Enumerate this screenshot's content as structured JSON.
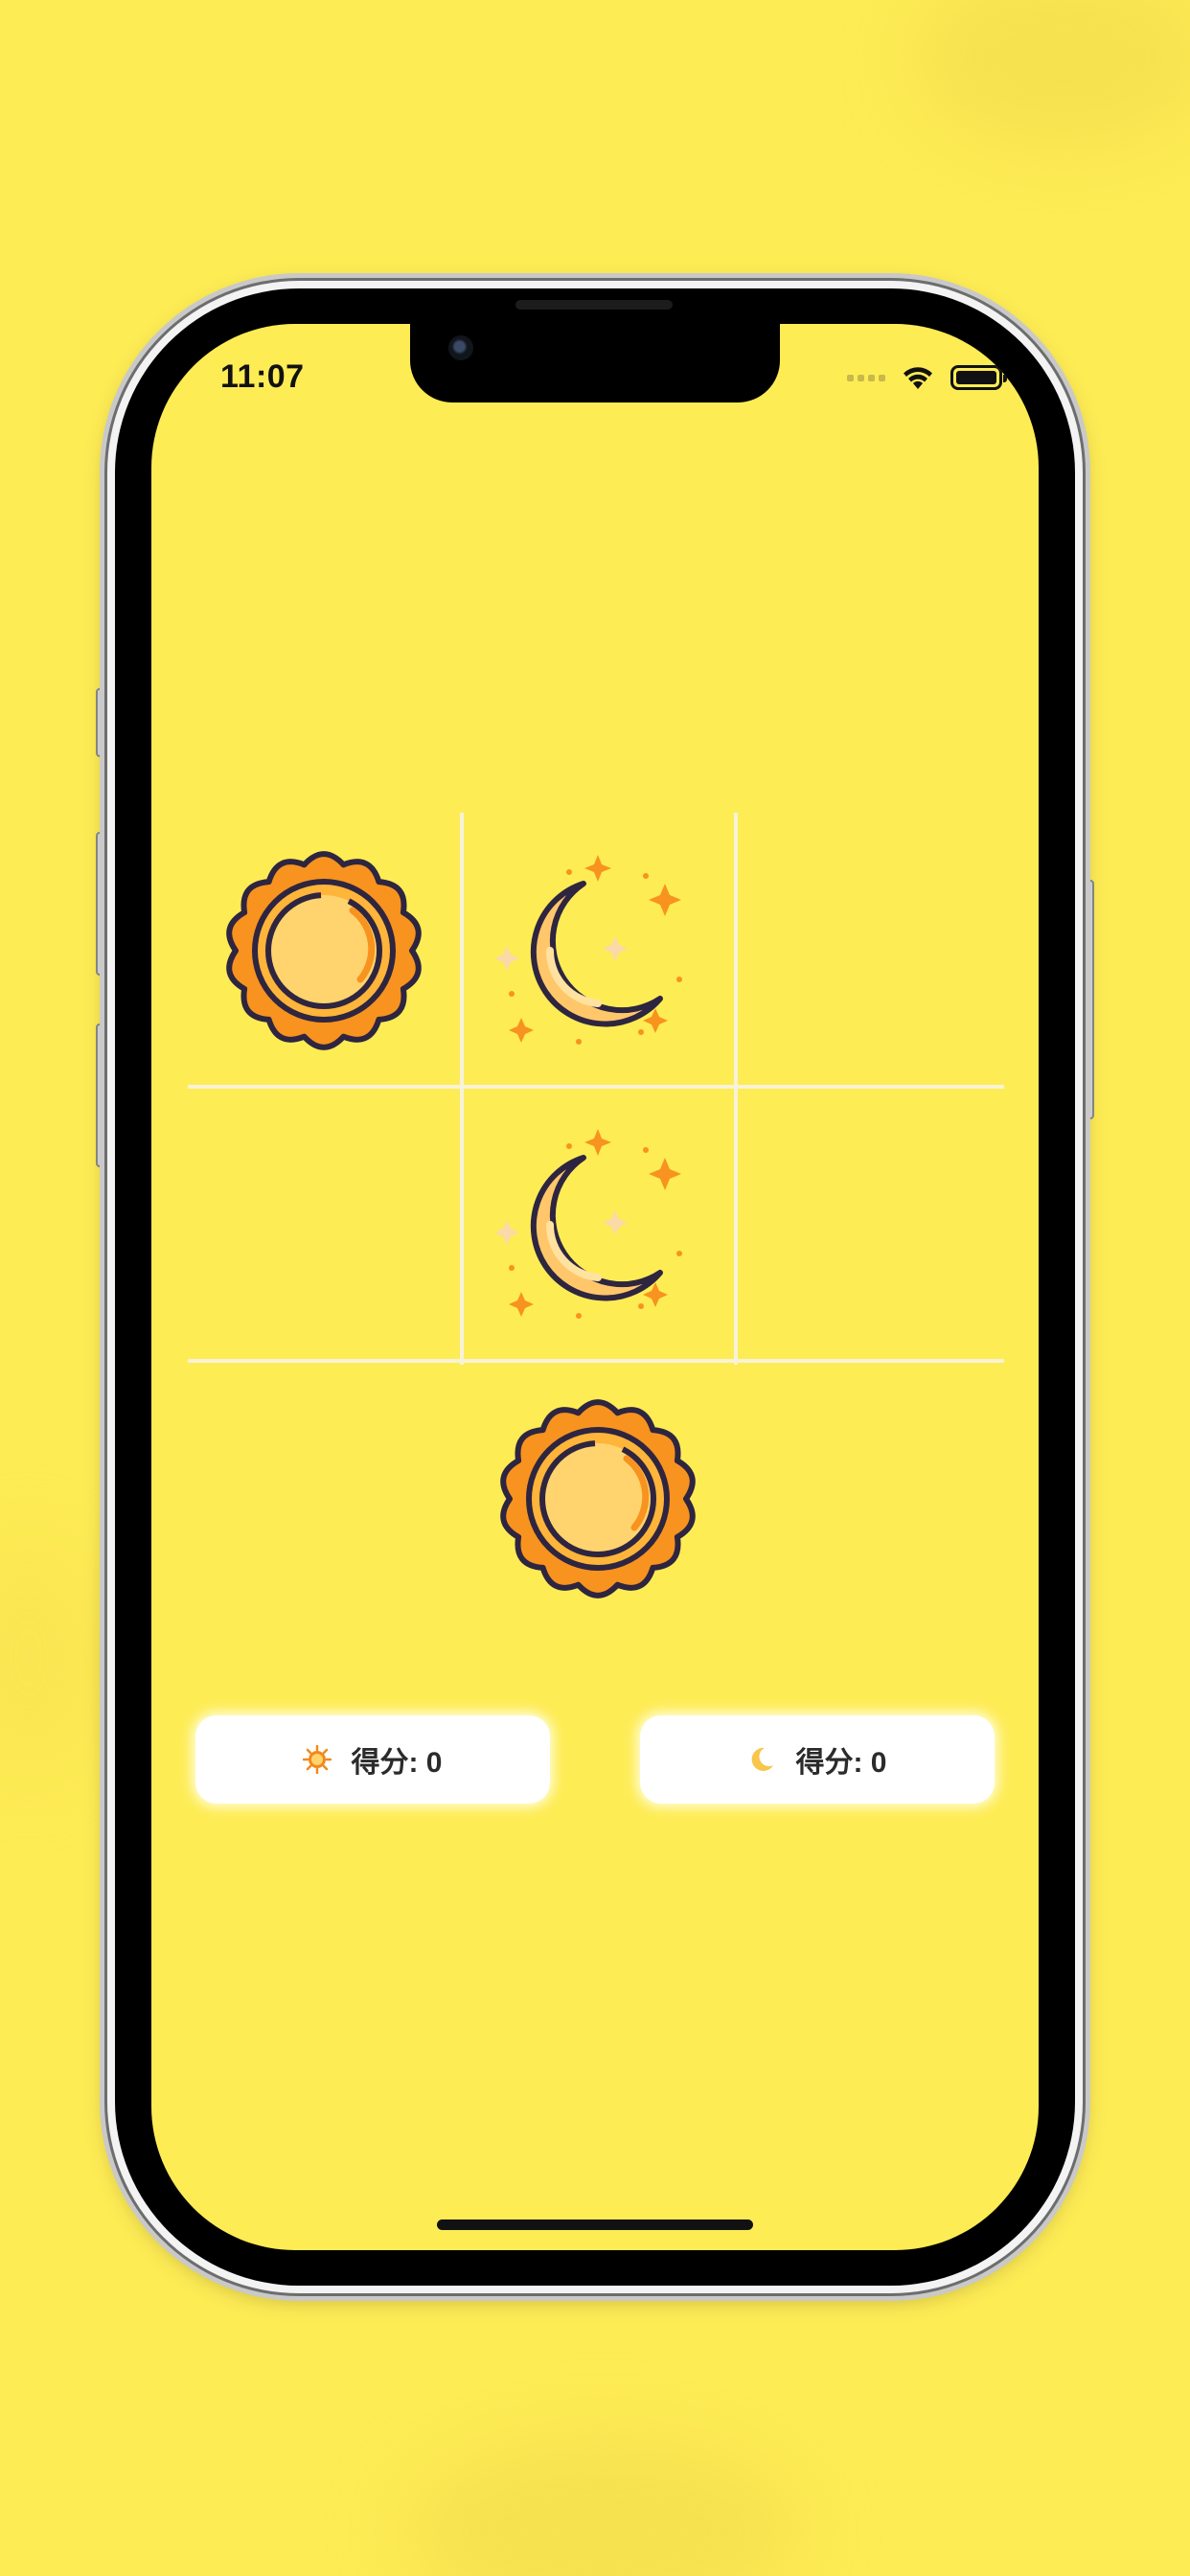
{
  "status_bar": {
    "time": "11:07"
  },
  "board": {
    "cells": [
      "sun",
      "moon",
      "",
      "",
      "moon",
      "",
      "",
      "sun",
      ""
    ]
  },
  "scores": {
    "sun": {
      "icon": "sun-icon",
      "label": "得分: 0"
    },
    "moon": {
      "icon": "moon-icon",
      "label": "得分: 0"
    }
  },
  "colors": {
    "background": "#FEEC55",
    "grid_line": "#F7F3D8",
    "sun_orange": "#F7931E",
    "sun_center": "#FFD36E",
    "outline": "#2E2540"
  }
}
